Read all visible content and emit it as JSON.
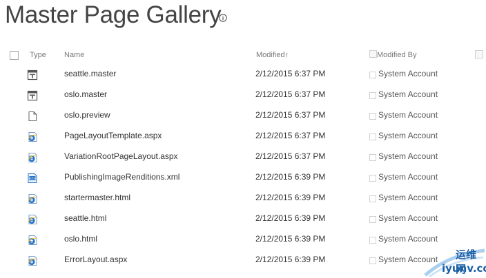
{
  "page": {
    "title": "Master Page Gallery"
  },
  "columns": {
    "type": "Type",
    "name": "Name",
    "modified": "Modified",
    "modified_sort_arrow": "↑",
    "modified_by": "Modified By"
  },
  "rows": [
    {
      "icon": "master-page-icon",
      "name": "seattle.master",
      "modified": "2/12/2015 6:37 PM",
      "modified_by": "System Account"
    },
    {
      "icon": "master-page-icon",
      "name": "oslo.master",
      "modified": "2/12/2015 6:37 PM",
      "modified_by": "System Account"
    },
    {
      "icon": "generic-file-icon",
      "name": "oslo.preview",
      "modified": "2/12/2015 6:37 PM",
      "modified_by": "System Account"
    },
    {
      "icon": "ie-page-icon",
      "name": "PageLayoutTemplate.aspx",
      "modified": "2/12/2015 6:37 PM",
      "modified_by": "System Account"
    },
    {
      "icon": "ie-page-icon",
      "name": "VariationRootPageLayout.aspx",
      "modified": "2/12/2015 6:37 PM",
      "modified_by": "System Account"
    },
    {
      "icon": "xml-file-icon",
      "name": "PublishingImageRenditions.xml",
      "modified": "2/12/2015 6:39 PM",
      "modified_by": "System Account"
    },
    {
      "icon": "ie-page-icon",
      "name": "startermaster.html",
      "modified": "2/12/2015 6:39 PM",
      "modified_by": "System Account"
    },
    {
      "icon": "ie-page-icon",
      "name": "seattle.html",
      "modified": "2/12/2015 6:39 PM",
      "modified_by": "System Account"
    },
    {
      "icon": "ie-page-icon",
      "name": "oslo.html",
      "modified": "2/12/2015 6:39 PM",
      "modified_by": "System Account"
    },
    {
      "icon": "ie-page-icon",
      "name": "ErrorLayout.aspx",
      "modified": "2/12/2015 6:39 PM",
      "modified_by": "System Account"
    }
  ],
  "watermark": {
    "top": "运维网",
    "bottom": "iyunv.com"
  },
  "colors": {
    "ie_blue": "#2a74c9",
    "link_text": "#333333",
    "title_text": "#444444"
  }
}
